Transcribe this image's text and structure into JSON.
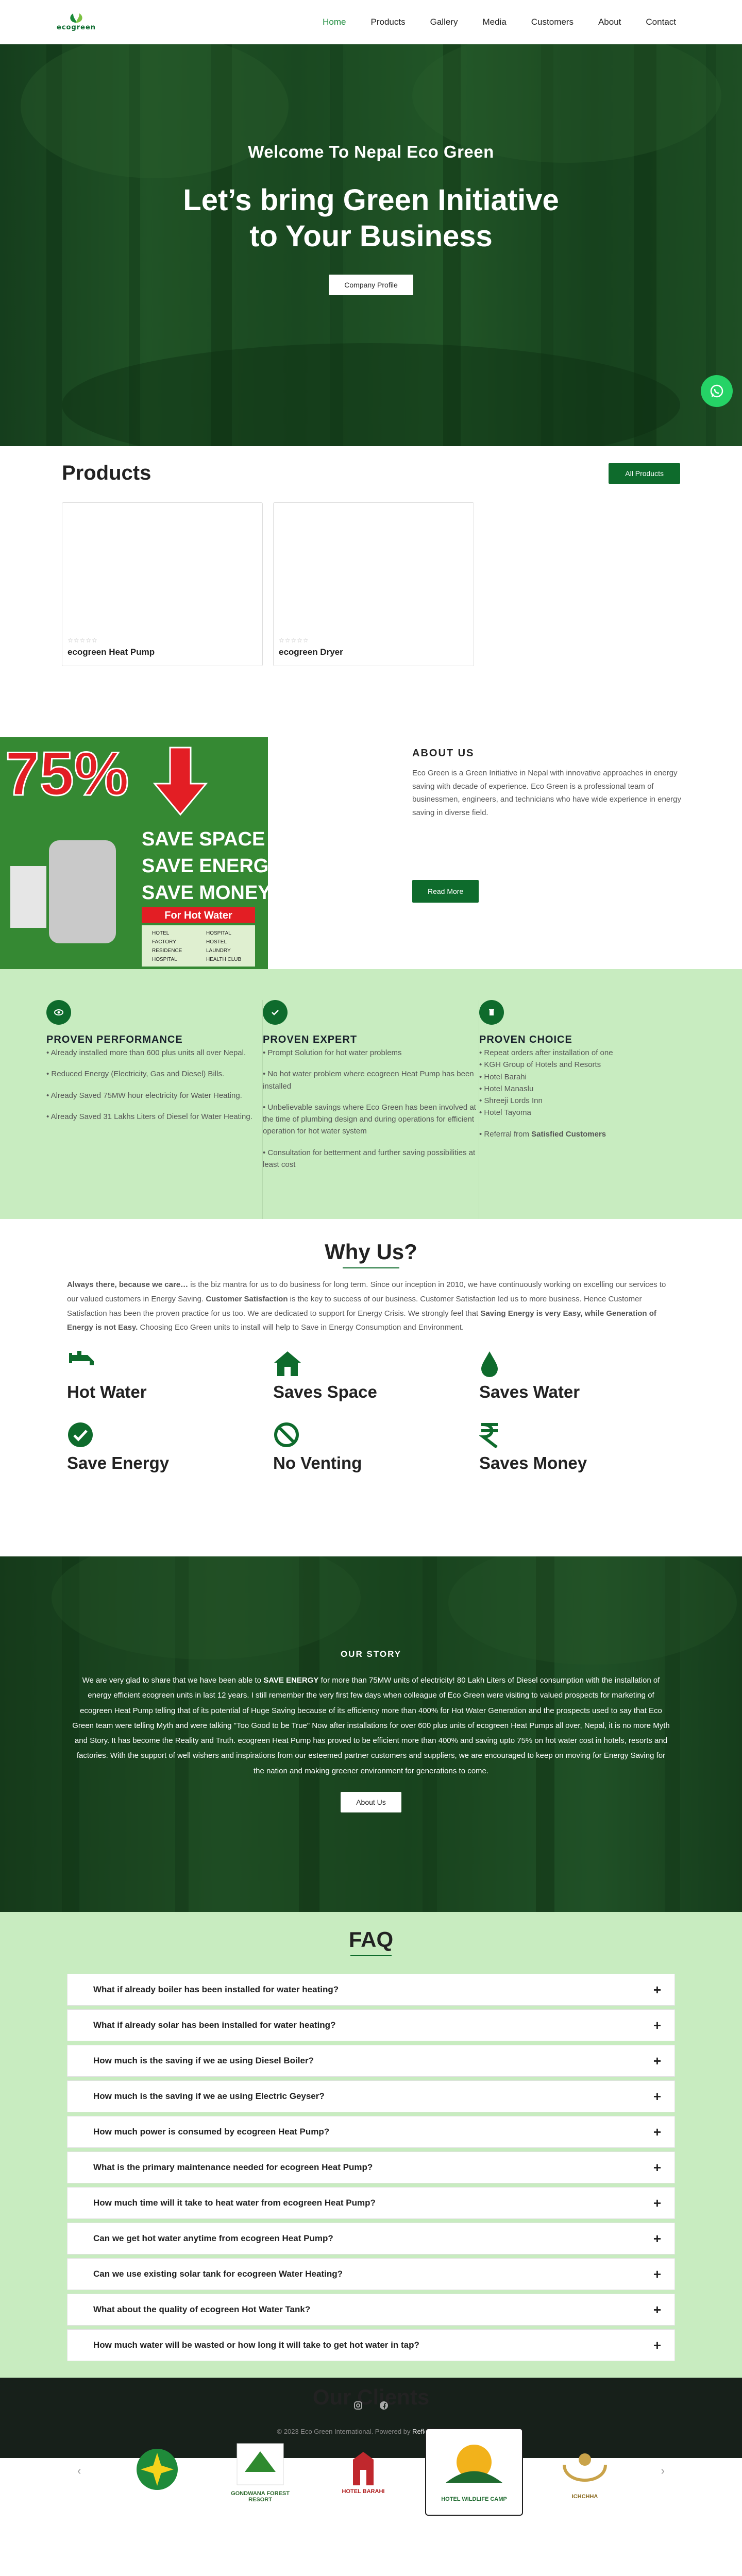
{
  "brand": {
    "logo_text": "ecogreen"
  },
  "nav": {
    "items": [
      {
        "label": "Home",
        "active": true
      },
      {
        "label": "Products",
        "active": false
      },
      {
        "label": "Gallery",
        "active": false
      },
      {
        "label": "Media",
        "active": false
      },
      {
        "label": "Customers",
        "active": false
      },
      {
        "label": "About",
        "active": false
      },
      {
        "label": "Contact",
        "active": false
      }
    ]
  },
  "hero": {
    "subtitle": "Welcome To Nepal Eco Green",
    "title_line1": "Let’s bring Green Initiative",
    "title_line2": "to Your Business",
    "button": "Company Profile"
  },
  "products": {
    "heading": "Products",
    "all_button": "All Products",
    "items": [
      {
        "name": "ecogreen Heat Pump",
        "stars": "☆☆☆☆☆"
      },
      {
        "name": "ecogreen Dryer",
        "stars": "☆☆☆☆☆"
      }
    ]
  },
  "about": {
    "heading": "ABOUT US",
    "text": "Eco Green is a Green Initiative in Nepal with innovative approaches in energy saving with decade of experience. Eco Green is a professional team of businessmen, engineers, and technicians who have wide experience in energy saving in diverse field.",
    "button": "Read More",
    "promo": {
      "percent": "75%",
      "lines": [
        "SAVE SPACE",
        "SAVE ENERGY",
        "SAVE MONEY"
      ],
      "tag": "For Hot Water",
      "list": [
        "HOTEL",
        "HOSPITAL",
        "FACTORY",
        "HOSTEL",
        "RESIDENCE",
        "LAUNDRY",
        "HOSPITAL",
        "HEALTH CLUB"
      ]
    }
  },
  "features": [
    {
      "title": "PROVEN PERFORMANCE",
      "icon": "eye-icon",
      "items": [
        "Already installed more than 600 plus units all over Nepal.",
        "Reduced Energy (Electricity, Gas and Diesel) Bills.",
        "Already Saved 75MW hour electricity for Water Heating.",
        "Already Saved 31 Lakhs Liters of Diesel for Water Heating."
      ]
    },
    {
      "title": "PROVEN EXPERT",
      "icon": "check-icon",
      "items": [
        "Prompt Solution for hot water problems",
        "No hot water problem where ecogreen Heat Pump has been installed",
        "Unbelievable savings where Eco Green has been involved at the time of plumbing design and during operations for efficient operation for hot water system",
        "Consultation for betterment and further saving possibilities at least cost"
      ]
    },
    {
      "title": "PROVEN CHOICE",
      "icon": "trash-icon",
      "items_tight": [
        "Repeat orders after installation of one",
        "KGH Group of Hotels and Resorts",
        "Hotel Barahi",
        "Hotel Manaslu",
        "Shreeji Lords Inn",
        "Hotel Tayoma"
      ],
      "referral_prefix": "Referral from ",
      "referral_bold": "Satisfied Customers"
    }
  ],
  "why": {
    "heading": "Why Us?",
    "p_bold1": "Always there, because we care…",
    "p_part1": " is the biz mantra for us to do business for long term. Since our inception in 2010, we have continuously working on excelling our services to our valued customers in Energy Saving. ",
    "p_bold2": "Customer Satisfaction",
    "p_part2": " is the key to success of our business. Customer Satisfaction led us to more business. Hence Customer Satisfaction has been the proven practice for us too. We are dedicated to support for Energy Crisis. We strongly feel that ",
    "p_bold3": "Saving Energy is very Easy, while Generation of Energy is not Easy.",
    "p_part3": " Choosing Eco Green units to install will help to Save in Energy Consumption and Environment.",
    "items": [
      {
        "label": "Hot Water",
        "icon": "tap-icon"
      },
      {
        "label": "Saves Space",
        "icon": "house-icon"
      },
      {
        "label": "Saves Water",
        "icon": "water-drop-icon"
      },
      {
        "label": "Save Energy",
        "icon": "check-circle-icon"
      },
      {
        "label": "No Venting",
        "icon": "ban-icon"
      },
      {
        "label": "Saves Money",
        "icon": "rupee-icon"
      }
    ]
  },
  "story": {
    "heading": "OUR STORY",
    "t1": "We are very glad to share that we have been able to ",
    "b1": "SAVE ENERGY",
    "t2": " for more than 75MW units of electricity! 80 Lakh Liters of Diesel consumption with the installation of energy efficient ecogreen units in last 12 years. I still remember the very first few days when colleague of Eco Green were visiting to valued prospects for marketing of ecogreen Heat Pump telling that of its potential of Huge Saving because of its efficiency more than 400% for Hot Water Generation and the prospects used to say that Eco Green team were telling Myth and were talking \"Too Good to be True\" Now after installations for over 600 plus units of ecogreen Heat Pumps all over, Nepal, it is no more Myth and Story. It has become the Reality and Truth. ecogreen Heat Pump has proved to be efficient more than 400% and saving upto 75% on hot water cost in hotels, resorts and factories. With the support of well wishers and inspirations from our esteemed partner customers and suppliers, we are encouraged to keep on moving for Energy Saving for the nation and making greener environment for generations to come.",
    "button": "About Us"
  },
  "faq": {
    "heading": "FAQ",
    "items": [
      "What if already boiler has been installed for water heating?",
      "What if already solar has been installed for water heating?",
      "How much is the saving if we ae using Diesel Boiler?",
      "How much is the saving if we ae using Electric Geyser?",
      "How much power is consumed by ecogreen Heat Pump?",
      "What is the primary maintenance needed for ecogreen Heat Pump?",
      "How much time will it take to heat water from ecogreen Heat Pump?",
      "Can we get hot water anytime from ecogreen Heat Pump?",
      "Can we use existing solar tank for ecogreen Water Heating?",
      "What about the quality of ecogreen Hot Water Tank?",
      "How much water will be wasted or how long it will take to get hot water in tap?"
    ]
  },
  "clients": {
    "heading": "Our Clients",
    "logos": [
      "",
      "GONDWANA FOREST RESORT",
      "HOTEL BARAHI",
      "HOTEL WILDLIFE CAMP",
      "ICHCHHA"
    ]
  },
  "footer": {
    "copy_prefix": "© 2023 Eco Green International. Powered by ",
    "copy_brand": "Reflex IT Solution"
  },
  "colors": {
    "brand_green": "#0e6b2c",
    "mint": "#c8ecc0",
    "whatsapp": "#25d366"
  }
}
